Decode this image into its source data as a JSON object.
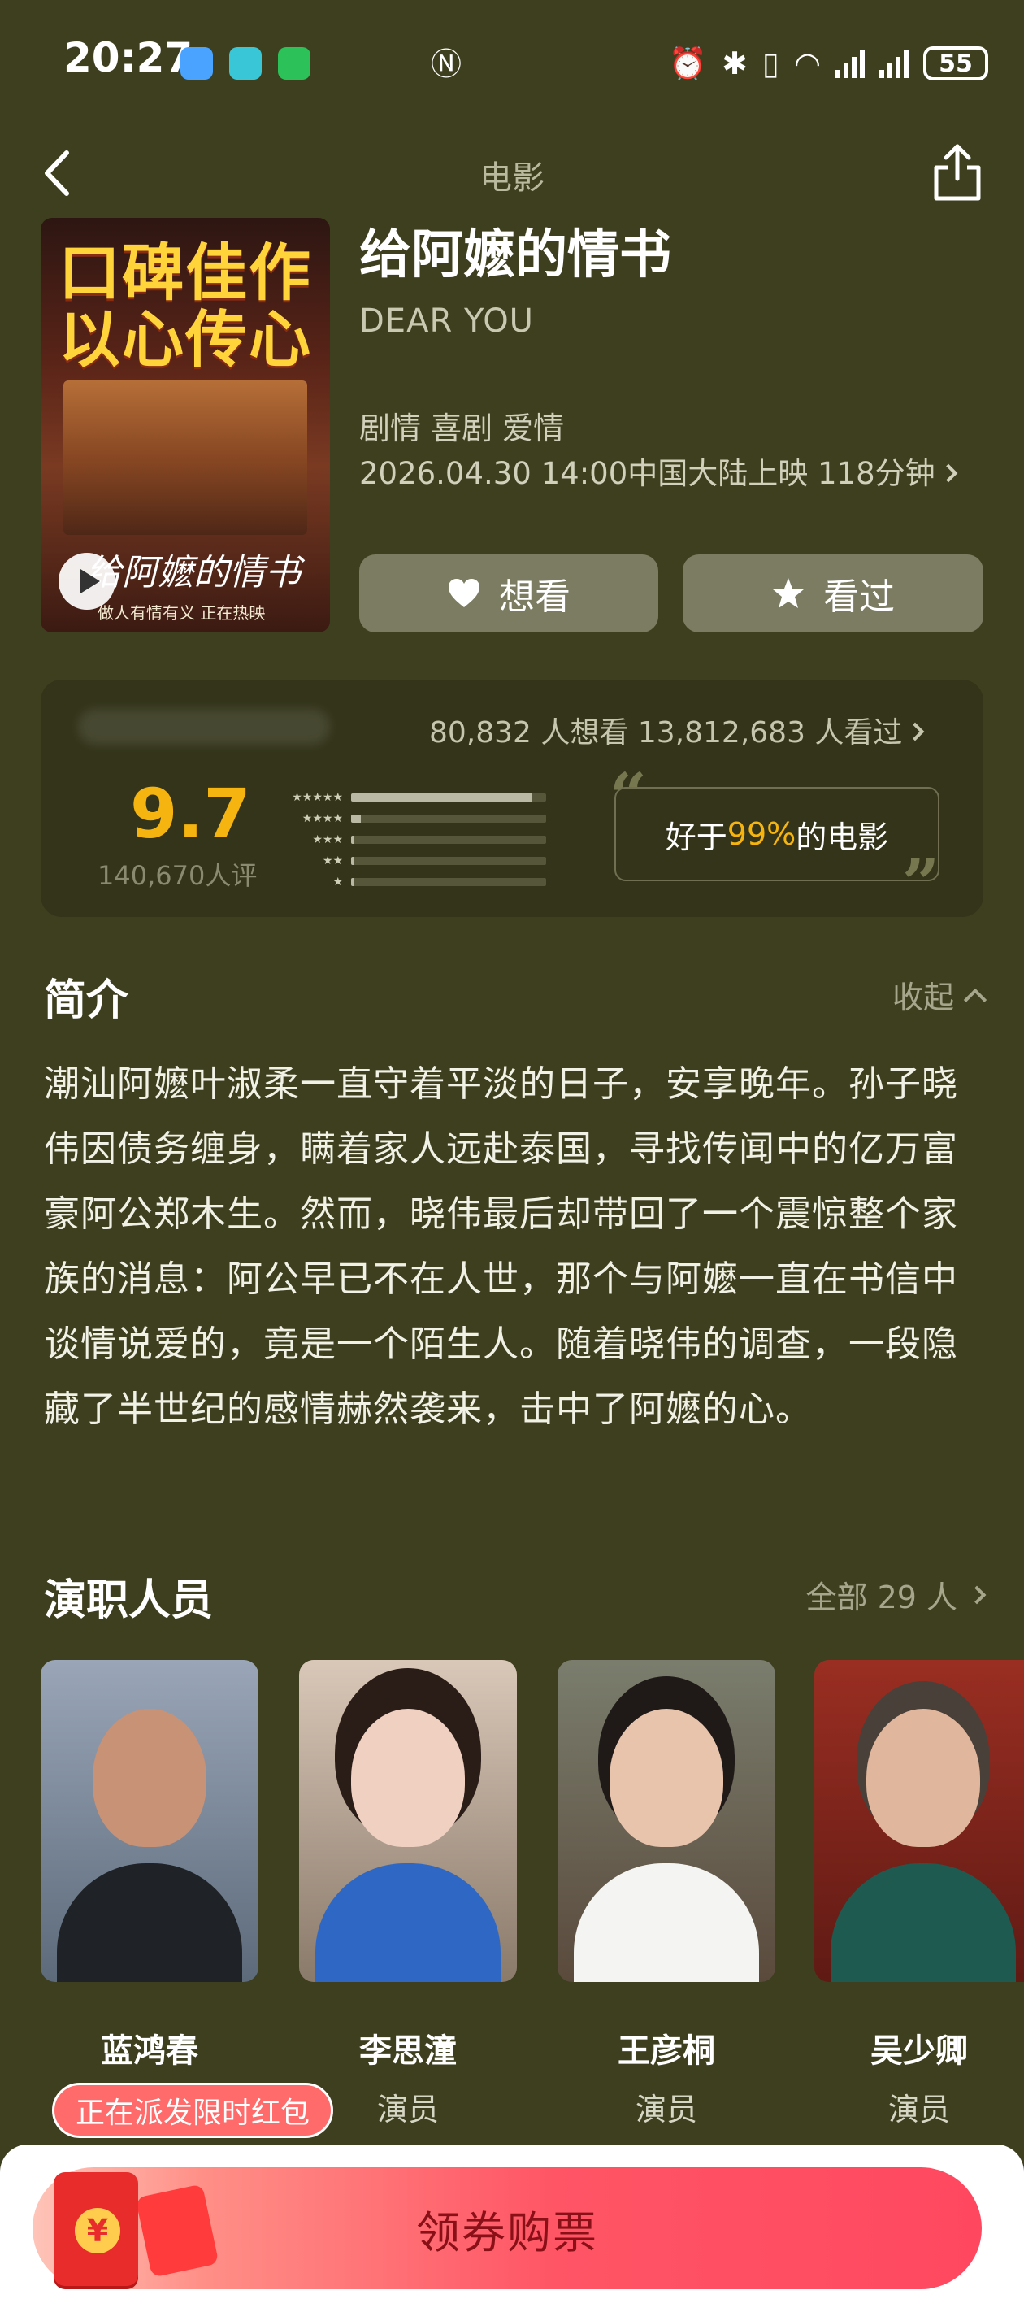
{
  "status_bar": {
    "time": "20:27",
    "battery": "55"
  },
  "header": {
    "title": "电影"
  },
  "movie": {
    "poster_text_line1": "口碑佳作",
    "poster_text_line2": "以心传心",
    "poster_script": "给阿嬷的情书",
    "poster_tagline": "做人有情有义 正在热映",
    "title": "给阿嬷的情书",
    "english_title": "DEAR YOU",
    "genres": "剧情 喜剧 爱情",
    "release": "2026.04.30 14:00中国大陆上映 118分钟",
    "want_label": "想看",
    "seen_label": "看过"
  },
  "rating": {
    "counts": "80,832 人想看  13,812,683 人看过",
    "score": "9.7",
    "raters": "140,670人评",
    "distribution": [
      0.93,
      0.05,
      0.01,
      0.005,
      0.005
    ],
    "star_labels": [
      "★★★★★",
      "★★★★",
      "★★★",
      "★★",
      "★"
    ],
    "compare_prefix": "好于",
    "compare_pct": "99%",
    "compare_suffix": "的电影",
    "colors": {
      "accent": "#f5b40f"
    }
  },
  "synopsis": {
    "title": "简介",
    "toggle": "收起",
    "text": "潮汕阿嬷叶淑柔一直守着平淡的日子，安享晚年。孙子晓伟因债务缠身，瞒着家人远赴泰国，寻找传闻中的亿万富豪阿公郑木生。然而，晓伟最后却带回了一个震惊整个家族的消息：阿公早已不在人世，那个与阿嬷一直在书信中谈情说爱的，竟是一个陌生人。随着晓伟的调查，一段隐藏了半世纪的感情赫然袭来，击中了阿嬷的心。"
  },
  "cast": {
    "title": "演职人员",
    "all_link": "全部 29 人",
    "members": [
      {
        "name": "蓝鸿春",
        "role": ""
      },
      {
        "name": "李思潼",
        "role": "演员"
      },
      {
        "name": "王彦桐",
        "role": "演员"
      },
      {
        "name": "吴少卿",
        "role": "演员"
      }
    ]
  },
  "bottom": {
    "promo": "正在派发限时红包",
    "buy_label": "领券购票",
    "coin_symbol": "¥"
  }
}
